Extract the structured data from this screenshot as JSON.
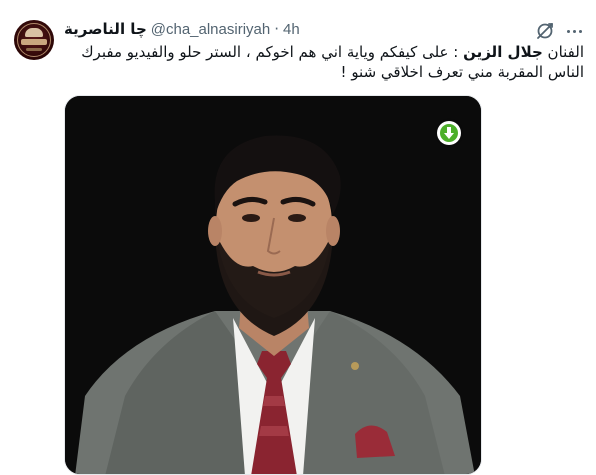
{
  "tweet": {
    "author_name": "چا الناصرية",
    "handle": "@cha_alnasiriyah",
    "separator": "·",
    "time": "4h",
    "text_prefix": "الفنان ",
    "text_bold": "جلال الزين",
    "text_rest": " : على كيفكم وياية اني هم اخوكم ، الستر حلو والفيديو مفبرك الناس المقربة مني تعرف اخلاقي شنو !",
    "media_alt": "photo"
  },
  "icons": {
    "grok": "grok-icon",
    "more": "more-icon",
    "download": "download-icon"
  },
  "colors": {
    "text": "#0f1419",
    "muted": "#536471",
    "download_green": "#4caf2a",
    "suit": "#6f7470",
    "tie": "#8a2430"
  }
}
